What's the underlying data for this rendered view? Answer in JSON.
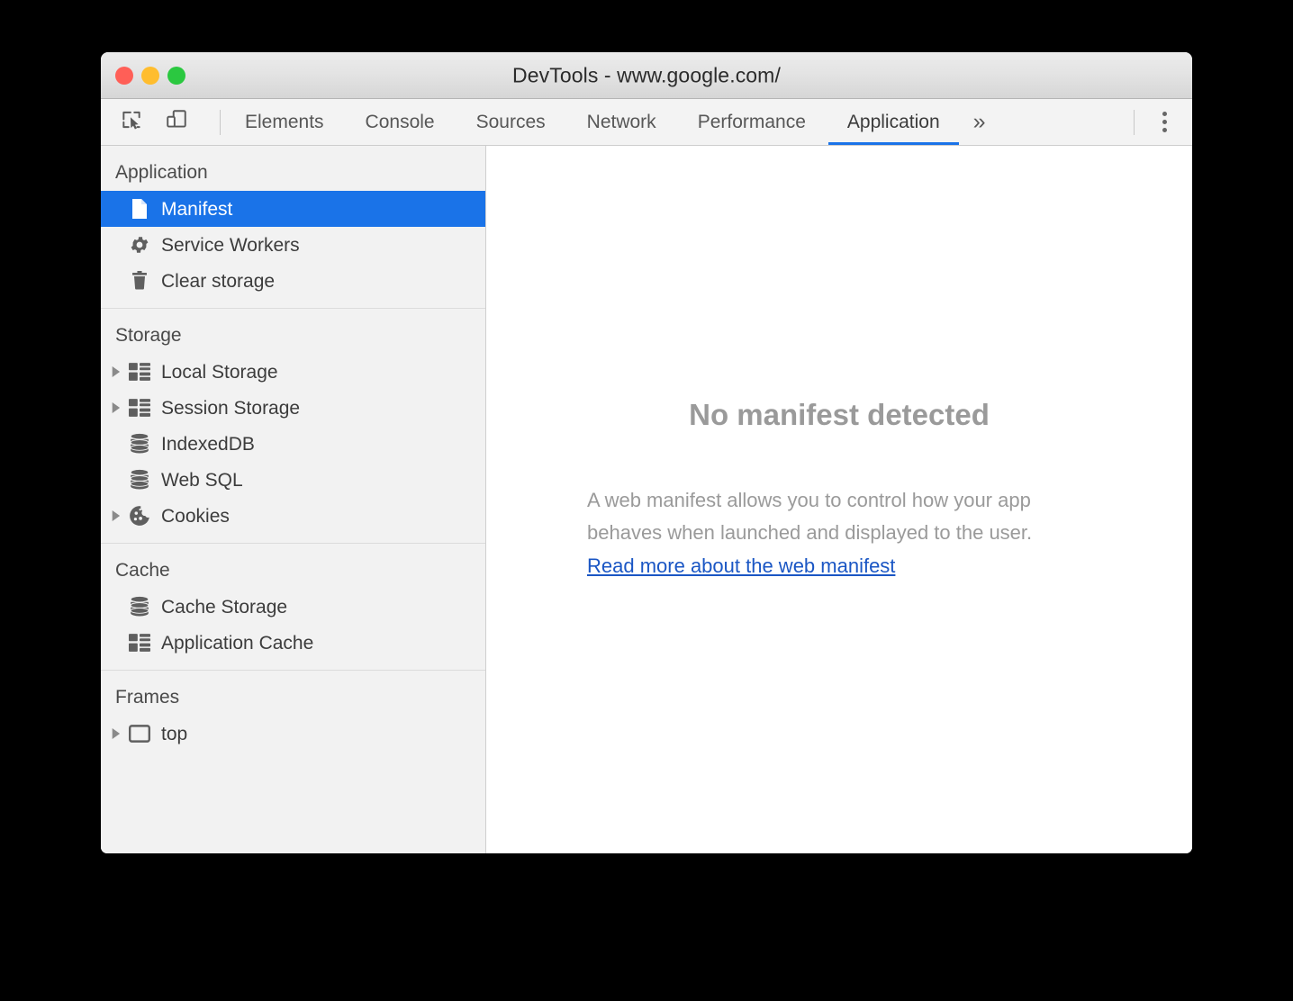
{
  "window": {
    "title": "DevTools - www.google.com/",
    "traffic_lights": [
      {
        "name": "close",
        "color": "#ff5f57"
      },
      {
        "name": "minimize",
        "color": "#ffbd2e"
      },
      {
        "name": "maximize",
        "color": "#2bc840"
      }
    ]
  },
  "toolbar": {
    "icons": [
      {
        "name": "inspect-element-icon",
        "label": "Inspect element"
      },
      {
        "name": "device-toolbar-icon",
        "label": "Toggle device toolbar"
      }
    ],
    "tabs": [
      {
        "label": "Elements",
        "active": false
      },
      {
        "label": "Console",
        "active": false
      },
      {
        "label": "Sources",
        "active": false
      },
      {
        "label": "Network",
        "active": false
      },
      {
        "label": "Performance",
        "active": false
      },
      {
        "label": "Application",
        "active": true
      }
    ],
    "overflow_label": "»",
    "more_menu_label": "Customize and control DevTools",
    "active_tab": "Application",
    "accent_color": "#1a73e8"
  },
  "sidebar": {
    "sections": [
      {
        "title": "Application",
        "items": [
          {
            "label": "Manifest",
            "icon": "document-icon",
            "selected": true,
            "expandable": false
          },
          {
            "label": "Service Workers",
            "icon": "gear-icon",
            "selected": false,
            "expandable": false
          },
          {
            "label": "Clear storage",
            "icon": "trash-icon",
            "selected": false,
            "expandable": false
          }
        ]
      },
      {
        "title": "Storage",
        "items": [
          {
            "label": "Local Storage",
            "icon": "table-icon",
            "selected": false,
            "expandable": true
          },
          {
            "label": "Session Storage",
            "icon": "table-icon",
            "selected": false,
            "expandable": true
          },
          {
            "label": "IndexedDB",
            "icon": "database-icon",
            "selected": false,
            "expandable": false
          },
          {
            "label": "Web SQL",
            "icon": "database-icon",
            "selected": false,
            "expandable": false
          },
          {
            "label": "Cookies",
            "icon": "cookie-icon",
            "selected": false,
            "expandable": true
          }
        ]
      },
      {
        "title": "Cache",
        "items": [
          {
            "label": "Cache Storage",
            "icon": "database-icon",
            "selected": false,
            "expandable": false
          },
          {
            "label": "Application Cache",
            "icon": "table-icon",
            "selected": false,
            "expandable": false
          }
        ]
      },
      {
        "title": "Frames",
        "items": [
          {
            "label": "top",
            "icon": "frame-icon",
            "selected": false,
            "expandable": true
          }
        ]
      }
    ]
  },
  "main": {
    "title": "No manifest detected",
    "description": "A web manifest allows you to control how your app behaves when launched and displayed to the user.",
    "link_text": "Read more about the web manifest",
    "link_color": "#1a56c4"
  }
}
